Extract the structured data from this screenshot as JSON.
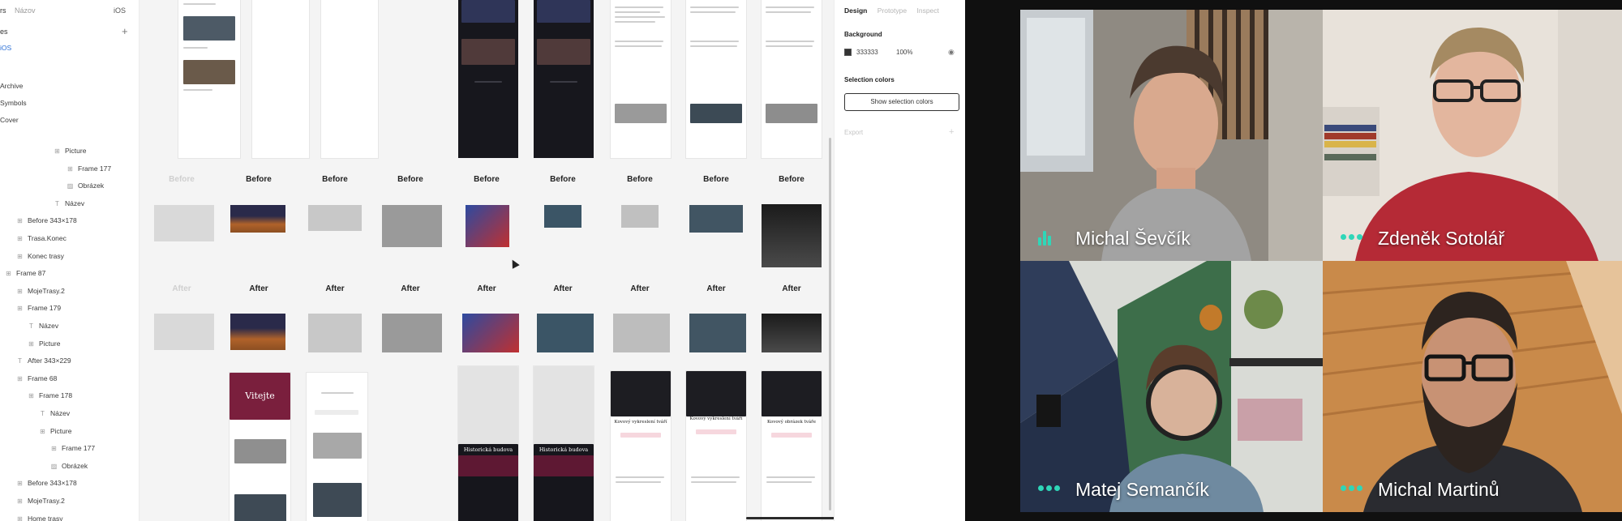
{
  "figma": {
    "topbar": {
      "doc_fragment": "rs",
      "tab": "Názov",
      "file_tab": "iOS"
    },
    "pages_header": "es",
    "page_selected": "iOS",
    "pages": [
      "Archive",
      "Symbols",
      "Cover"
    ],
    "layers": [
      {
        "label": "Picture",
        "icon": "grid-icon"
      },
      {
        "label": "Frame 177",
        "icon": "grid-icon"
      },
      {
        "label": "Obrázek",
        "icon": "image-icon"
      },
      {
        "label": "Název",
        "icon": "text-icon"
      },
      {
        "label": "Before 343×178",
        "icon": "grid-icon"
      },
      {
        "label": "Trasa.Konec",
        "icon": "grid-icon"
      },
      {
        "label": "Konec trasy",
        "icon": "grid-icon"
      },
      {
        "label": "Frame 87",
        "icon": "grid-icon"
      },
      {
        "label": "MojeTrasy.2",
        "icon": "grid-icon"
      },
      {
        "label": "Frame 179",
        "icon": "grid-icon"
      },
      {
        "label": "Název",
        "icon": "text-icon"
      },
      {
        "label": "Picture",
        "icon": "grid-icon"
      },
      {
        "label": "After 343×229",
        "icon": "text-icon"
      },
      {
        "label": "Frame 68",
        "icon": "grid-icon"
      },
      {
        "label": "Frame 178",
        "icon": "grid-icon"
      },
      {
        "label": "Název",
        "icon": "text-icon"
      },
      {
        "label": "Picture",
        "icon": "grid-icon"
      },
      {
        "label": "Frame 177",
        "icon": "grid-icon"
      },
      {
        "label": "Obrázek",
        "icon": "image-icon"
      },
      {
        "label": "Before 343×178",
        "icon": "grid-icon"
      },
      {
        "label": "MojeTrasy.2",
        "icon": "grid-icon"
      },
      {
        "label": "Home trasy",
        "icon": "grid-icon"
      }
    ],
    "canvas": {
      "row_before": [
        {
          "label": "Before",
          "faint": true
        },
        {
          "label": "Before"
        },
        {
          "label": "Before"
        },
        {
          "label": "Before"
        },
        {
          "label": "Before"
        },
        {
          "label": "Before"
        },
        {
          "label": "Before"
        },
        {
          "label": "Before"
        },
        {
          "label": "Before"
        }
      ],
      "row_after": [
        {
          "label": "After",
          "faint": true
        },
        {
          "label": "After"
        },
        {
          "label": "After"
        },
        {
          "label": "After"
        },
        {
          "label": "After"
        },
        {
          "label": "After"
        },
        {
          "label": "After"
        },
        {
          "label": "After"
        },
        {
          "label": "After"
        }
      ],
      "bottom_titles": {
        "maroon_title": "Vitejte",
        "dark1": "Historická budova",
        "dark2": "Historická budova",
        "light1": "Kovový vykreslení tváří",
        "light2": "Kovový vykreslení tváří",
        "light3": "Kovový obrázek tváře"
      }
    },
    "design_panel": {
      "tabs": [
        "Design",
        "Prototype",
        "Inspect"
      ],
      "active_tab": "Design",
      "background_label": "Background",
      "background_hex": "333333",
      "background_opacity": "100%",
      "selection_colors_label": "Selection colors",
      "show_selection_button": "Show selection colors",
      "export_label": "Export"
    }
  },
  "call": {
    "accent": "#2fd6b8",
    "participants": [
      {
        "name": "Michal Ševčík",
        "speaking": true
      },
      {
        "name": "Zdeněk Sotolář",
        "speaking": false
      },
      {
        "name": "Matej Semančík",
        "speaking": false
      },
      {
        "name": "Michal Martinů",
        "speaking": false
      }
    ]
  }
}
